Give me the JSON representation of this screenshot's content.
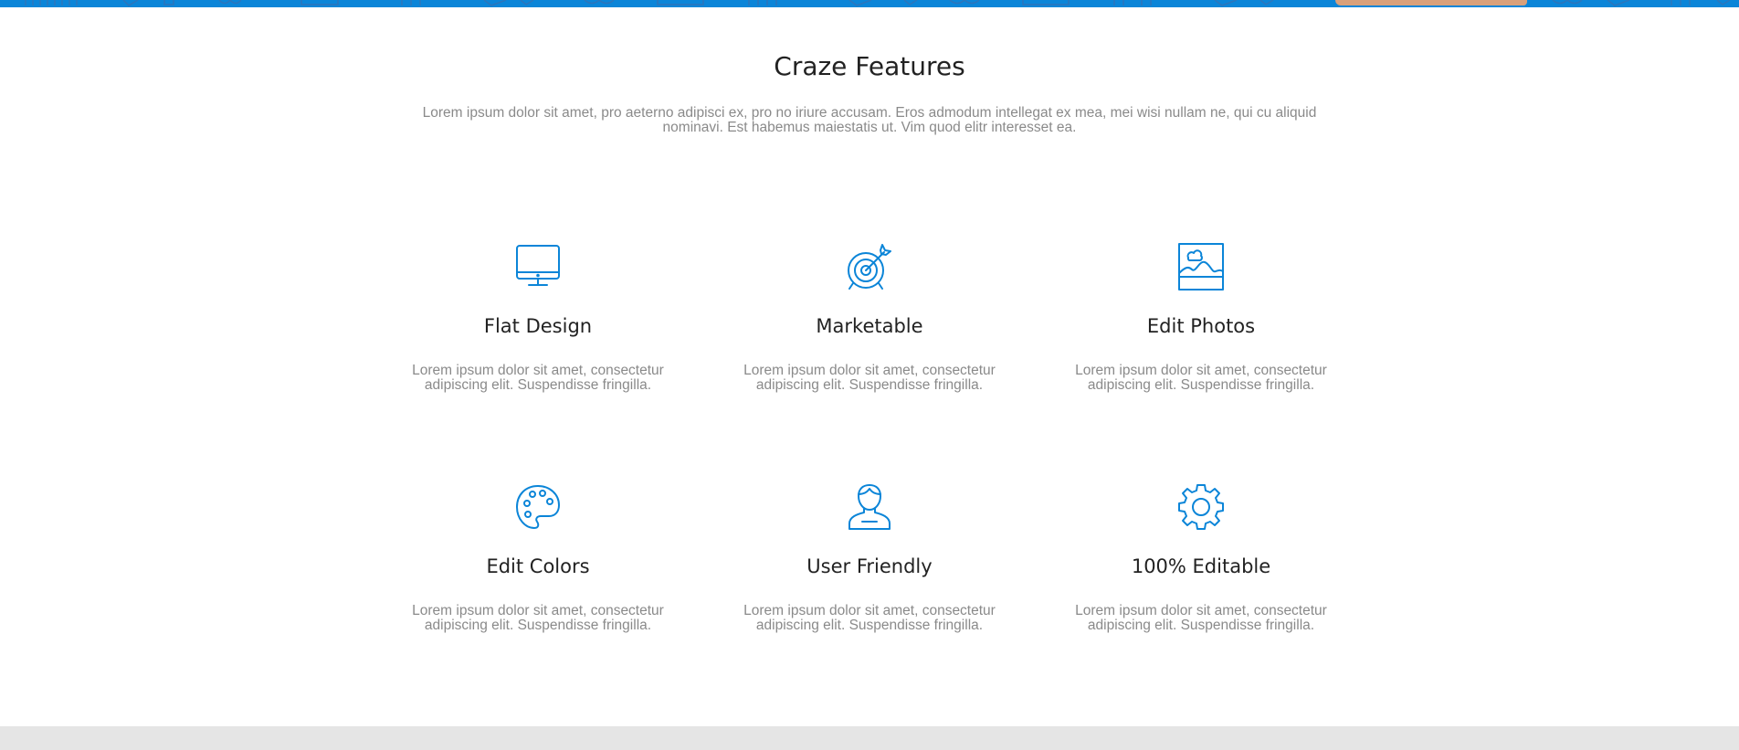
{
  "colors": {
    "accent": "#0b85d8",
    "title_text": "#222222",
    "body_text": "#8a8a8a",
    "footer_band": "#e5e5e5"
  },
  "section": {
    "title": "Craze Features",
    "description": "Lorem ipsum dolor sit amet, pro aeterno adipisci ex, pro no iriure accusam. Eros admodum intellegat ex mea, mei wisi nullam ne, qui cu aliquid nominavi. Est habemus maiestatis ut. Vim quod elitr interesset ea."
  },
  "features": [
    {
      "icon": "monitor-icon",
      "title": "Flat Design",
      "text": "Lorem ipsum dolor sit amet, consectetur adipiscing elit. Suspendisse fringilla."
    },
    {
      "icon": "target-icon",
      "title": "Marketable",
      "text": "Lorem ipsum dolor sit amet, consectetur adipiscing elit. Suspendisse fringilla."
    },
    {
      "icon": "image-icon",
      "title": "Edit Photos",
      "text": "Lorem ipsum dolor sit amet, consectetur adipiscing elit. Suspendisse fringilla."
    },
    {
      "icon": "palette-icon",
      "title": "Edit Colors",
      "text": "Lorem ipsum dolor sit amet, consectetur adipiscing elit. Suspendisse fringilla."
    },
    {
      "icon": "user-icon",
      "title": "User Friendly",
      "text": "Lorem ipsum dolor sit amet, consectetur adipiscing elit. Suspendisse fringilla."
    },
    {
      "icon": "gear-icon",
      "title": "100% Editable",
      "text": "Lorem ipsum dolor sit amet, consectetur adipiscing elit. Suspendisse fringilla."
    }
  ]
}
